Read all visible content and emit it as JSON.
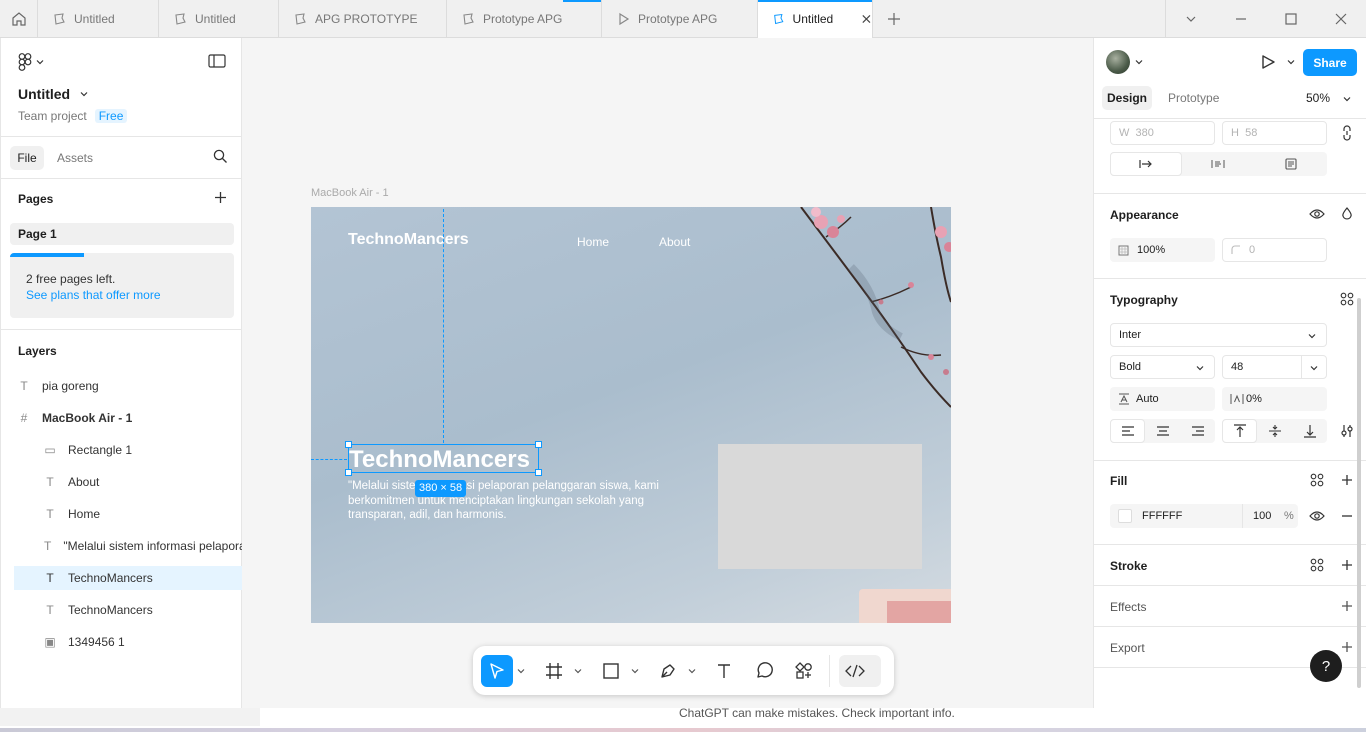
{
  "tabs": [
    {
      "label": "Untitled",
      "icon": "figma-file-icon"
    },
    {
      "label": "Untitled",
      "icon": "figma-file-icon"
    },
    {
      "label": "APG PROTOTYPE",
      "icon": "figma-file-icon"
    },
    {
      "label": "Prototype APG",
      "icon": "figma-file-icon"
    },
    {
      "label": "Prototype APG",
      "icon": "play-icon"
    },
    {
      "label": "Untitled",
      "icon": "figma-file-icon",
      "active": true
    }
  ],
  "file": {
    "name": "Untitled",
    "team": "Team project",
    "plan": "Free"
  },
  "left_tabs": {
    "file": "File",
    "assets": "Assets"
  },
  "pages": {
    "heading": "Pages",
    "items": [
      "Page 1"
    ],
    "usage_fraction": 0.33,
    "notice": "2 free pages left.",
    "notice_link": "See plans that offer more"
  },
  "layers": {
    "heading": "Layers",
    "items": [
      {
        "name": "pia goreng",
        "type": "text"
      },
      {
        "name": "MacBook Air - 1",
        "type": "frame"
      },
      {
        "name": "Rectangle 1",
        "type": "rectangle"
      },
      {
        "name": "About",
        "type": "text"
      },
      {
        "name": "Home",
        "type": "text"
      },
      {
        "name": "\"Melalui sistem informasi pelapora",
        "type": "text"
      },
      {
        "name": "TechnoMancers",
        "type": "text",
        "selected": true
      },
      {
        "name": "TechnoMancers",
        "type": "text"
      },
      {
        "name": "1349456 1",
        "type": "image"
      }
    ]
  },
  "canvas": {
    "frame_label": "MacBook Air - 1",
    "brand": "TechnoMancers",
    "nav": [
      "Home",
      "About"
    ],
    "headline": "TechnoMancers",
    "body_text": "\"Melalui sistem informasi pelaporan pelanggaran siswa, kami berkomitmen untuk menciptakan lingkungan sekolah yang transparan, adil, dan harmonis.",
    "size_badge": "380 × 58",
    "selection_color": "#0d99ff"
  },
  "right": {
    "tabs": {
      "design": "Design",
      "prototype": "Prototype"
    },
    "zoom": "50%",
    "share": "Share",
    "w_label": "W",
    "w_value": "380",
    "h_label": "H",
    "h_value": "58",
    "appearance": {
      "heading": "Appearance",
      "opacity": "100%",
      "radius": "0"
    },
    "typography": {
      "heading": "Typography",
      "font": "Inter",
      "weight": "Bold",
      "size": "48",
      "line_height": "Auto",
      "letter_spacing": "0%"
    },
    "fill": {
      "heading": "Fill",
      "hex": "FFFFFF",
      "opacity": "100",
      "unit": "%"
    },
    "stroke": "Stroke",
    "effects": "Effects",
    "export": "Export",
    "help": "?"
  },
  "status": "ChatGPT can make mistakes. Check important info."
}
